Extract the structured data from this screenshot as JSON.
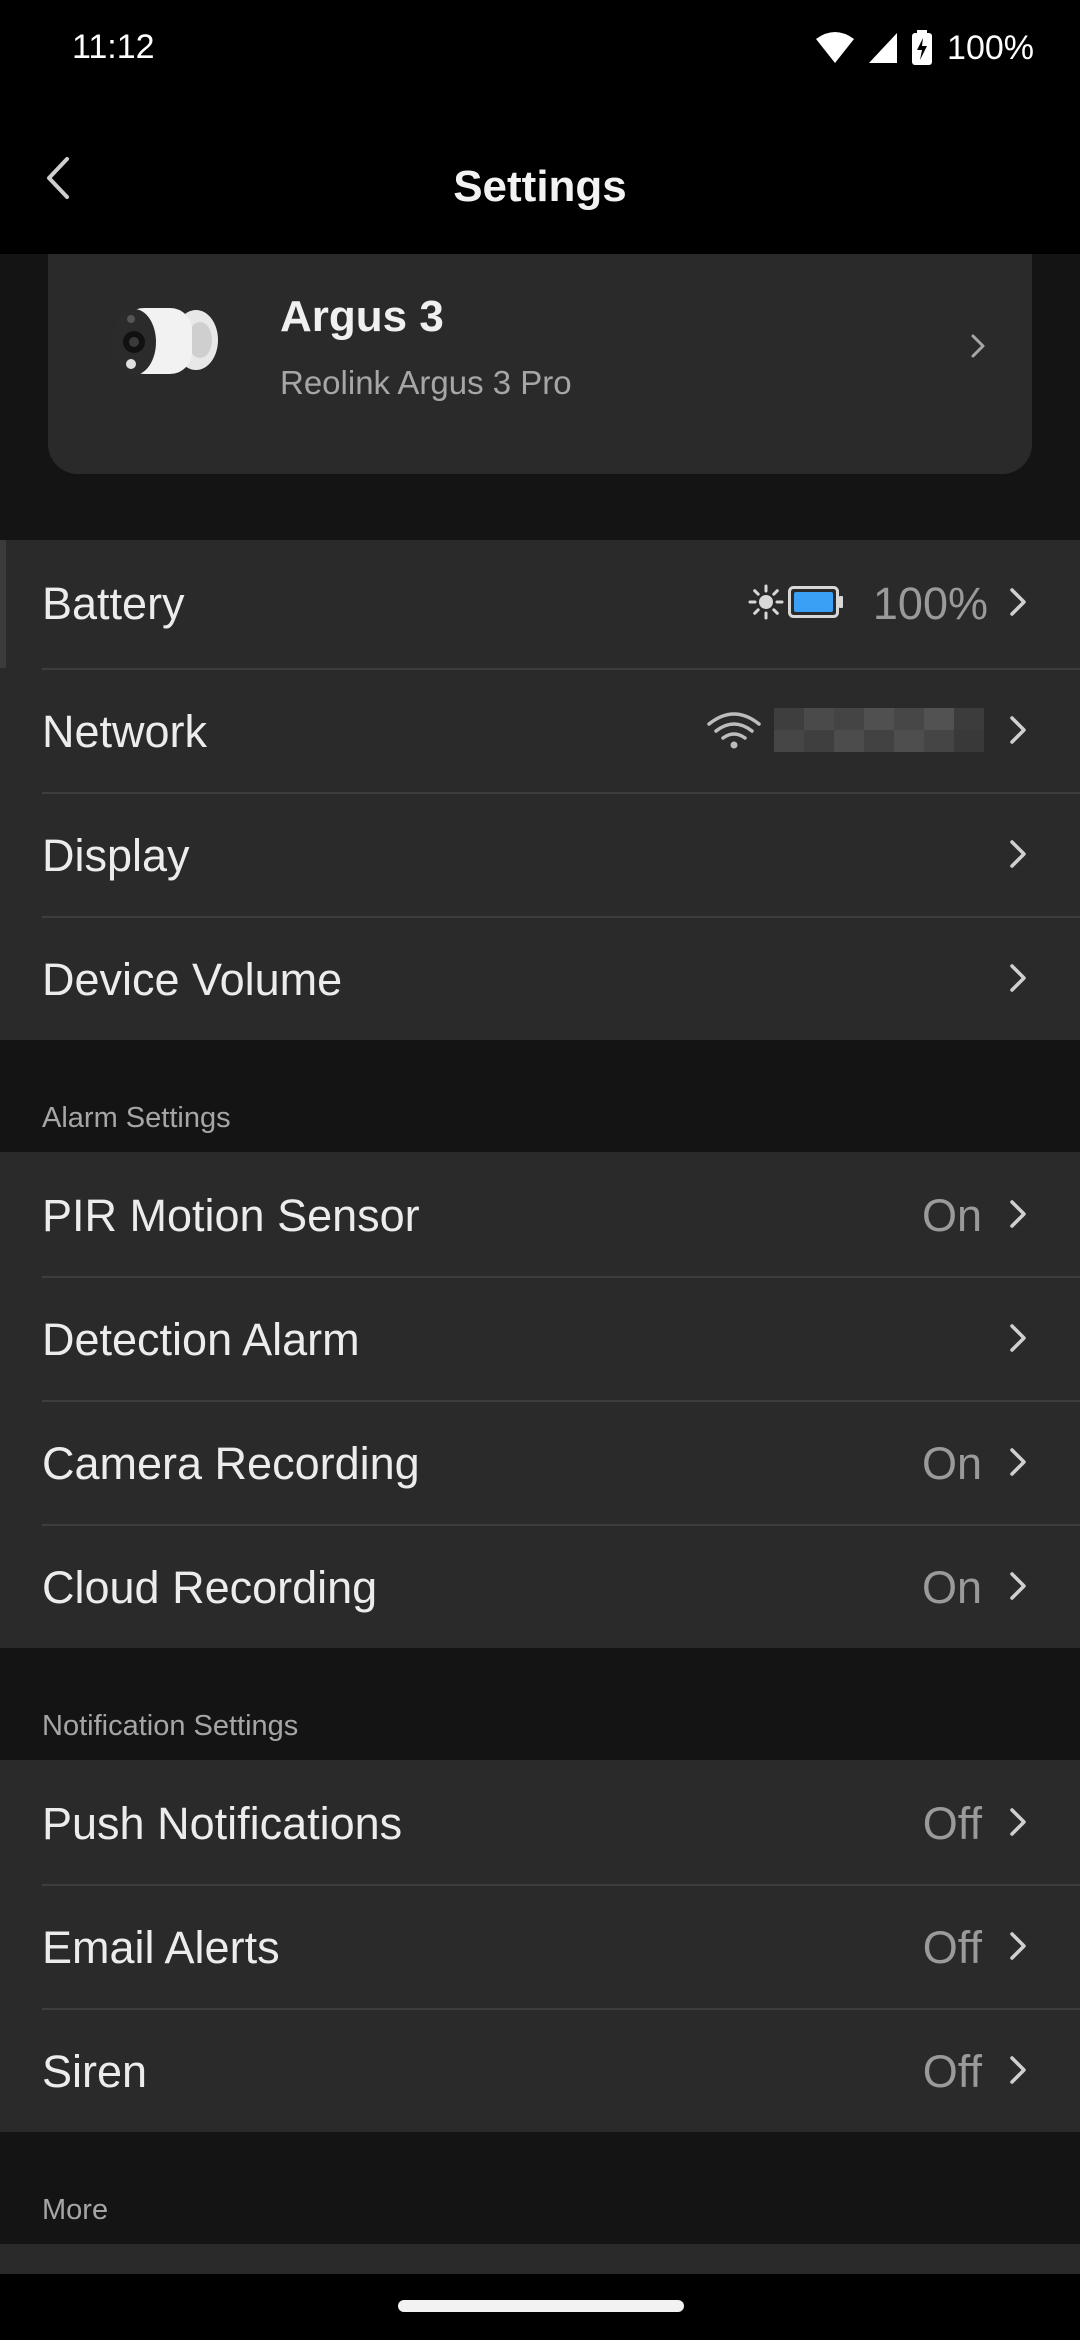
{
  "status_bar": {
    "time": "11:12",
    "battery": "100%",
    "icons": [
      "wifi-icon",
      "cellular-signal-icon",
      "battery-charging-icon"
    ]
  },
  "app_bar": {
    "title": "Settings",
    "back_icon": "back-chevron-icon"
  },
  "device": {
    "name": "Argus 3",
    "model": "Reolink Argus 3 Pro",
    "image_icon": "camera-image"
  },
  "general": [
    {
      "label": "Battery",
      "value": "100%",
      "meta_icons": [
        "sun-icon",
        "battery-icon"
      ]
    },
    {
      "label": "Network",
      "value": "",
      "meta_icons": [
        "wifi-icon",
        "redacted-ssid"
      ]
    },
    {
      "label": "Display",
      "value": ""
    },
    {
      "label": "Device Volume",
      "value": ""
    }
  ],
  "alarm_settings": {
    "header": "Alarm Settings",
    "items": [
      {
        "label": "PIR Motion Sensor",
        "value": "On"
      },
      {
        "label": "Detection Alarm",
        "value": ""
      },
      {
        "label": "Camera Recording",
        "value": "On"
      },
      {
        "label": "Cloud Recording",
        "value": "On"
      }
    ]
  },
  "notification_settings": {
    "header": "Notification Settings",
    "items": [
      {
        "label": "Push Notifications",
        "value": "Off"
      },
      {
        "label": "Email Alerts",
        "value": "Off"
      },
      {
        "label": "Siren",
        "value": "Off"
      }
    ]
  },
  "more": {
    "header": "More"
  },
  "colors": {
    "background": "#141414",
    "surface": "#2a2a2a",
    "text": "#ececec",
    "secondary_text": "#9a9a9a",
    "battery_fill": "#3aa0f5"
  }
}
